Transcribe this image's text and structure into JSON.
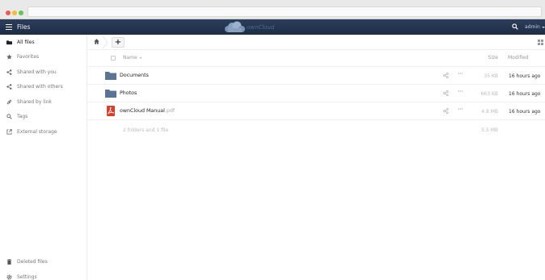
{
  "header": {
    "app_title": "Files",
    "brand": "ownCloud",
    "user": "admin"
  },
  "sidebar": {
    "items": [
      {
        "label": "All files",
        "icon": "folder-icon"
      },
      {
        "label": "Favorites",
        "icon": "star-icon"
      },
      {
        "label": "Shared with you",
        "icon": "share-icon"
      },
      {
        "label": "Shared with others",
        "icon": "share-icon"
      },
      {
        "label": "Shared by link",
        "icon": "link-icon"
      },
      {
        "label": "Tags",
        "icon": "tag-icon"
      },
      {
        "label": "External storage",
        "icon": "external-icon"
      }
    ],
    "deleted": "Deleted files",
    "settings": "Settings"
  },
  "table": {
    "col_name": "Name",
    "col_size": "Size",
    "col_modified": "Modified",
    "rows": [
      {
        "name": "Documents",
        "ext": "",
        "type": "folder",
        "size": "35 KB",
        "modified": "16 hours ago"
      },
      {
        "name": "Photos",
        "ext": "",
        "type": "folder",
        "size": "663 KB",
        "modified": "16 hours ago"
      },
      {
        "name": "ownCloud Manual",
        "ext": ".pdf",
        "type": "pdf",
        "size": "4.8 MB",
        "modified": "16 hours ago"
      }
    ],
    "summary_count": "2 folders and 1 file",
    "summary_size": "5.5 MB"
  },
  "colors": {
    "header_bg": "#1d2d44",
    "folder": "#5b7496",
    "pdf": "#d8402b"
  }
}
